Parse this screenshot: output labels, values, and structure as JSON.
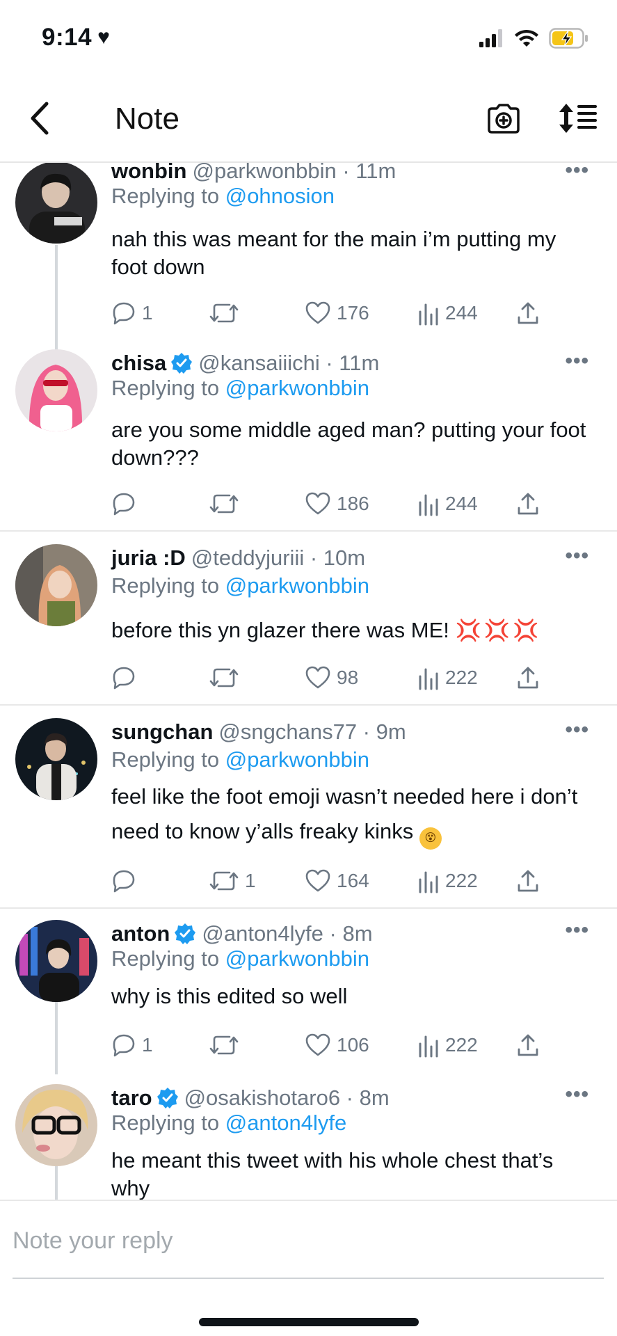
{
  "status_bar": {
    "time": "9:14",
    "heart_glyph": "♥",
    "icons": [
      "signal-icon",
      "wifi-icon",
      "battery-charging-icon"
    ]
  },
  "nav": {
    "back_icon": "chevron-left-icon",
    "title": "Note",
    "camera_icon": "camera-plus-icon",
    "sort_icon": "sort-list-icon"
  },
  "tweets": [
    {
      "name": "wonbin",
      "verified": false,
      "meta": "@parkwonbbin · 11m",
      "replying_prefix": "Replying to ",
      "replying_to": "@ohnosion",
      "text": "nah this was meant for the main i’m putting my foot down",
      "replies": "1",
      "retweets": "",
      "likes": "176",
      "views": "244"
    },
    {
      "name": "chisa",
      "verified": true,
      "meta": "@kansaiiichi · 11m",
      "replying_prefix": "Replying to ",
      "replying_to": "@parkwonbbin",
      "text": "are you some middle aged man? putting your foot down???",
      "replies": "",
      "retweets": "",
      "likes": "186",
      "views": "244"
    },
    {
      "name": "juria :D",
      "verified": false,
      "meta": "@teddyjuriii · 10m",
      "replying_prefix": "Replying to ",
      "replying_to": "@parkwonbbin",
      "text": "before this yn glazer there was ME!",
      "text_emoji": "💢💢💢",
      "replies": "",
      "retweets": "",
      "likes": "98",
      "views": "222"
    },
    {
      "name": "sungchan",
      "verified": false,
      "meta": "@sngchans77 · 9m",
      "replying_prefix": "Replying to ",
      "replying_to": "@parkwonbbin",
      "text": "feel like the foot emoji wasn’t needed here i don’t need to know y’alls freaky kinks",
      "text_emoji": "😵",
      "replies": "",
      "retweets": "1",
      "likes": "164",
      "views": "222"
    },
    {
      "name": "anton",
      "verified": true,
      "meta": "@anton4lyfe · 8m",
      "replying_prefix": "Replying to ",
      "replying_to": "@parkwonbbin",
      "text": "why is this edited so well",
      "replies": "1",
      "retweets": "",
      "likes": "106",
      "views": "222"
    },
    {
      "name": "taro",
      "verified": true,
      "meta": "@osakishotaro6 · 8m",
      "replying_prefix": "Replying to ",
      "replying_to": "@anton4lyfe",
      "text": "he meant this tweet with his whole chest that’s why"
    }
  ],
  "more_glyph": "•••",
  "composer": {
    "placeholder": "Note your reply"
  },
  "colors": {
    "link": "#1d9bf0",
    "muted": "#6b7682",
    "text": "#0f1419",
    "verified": "#1d9bf0",
    "divider": "#e8e8e8"
  }
}
